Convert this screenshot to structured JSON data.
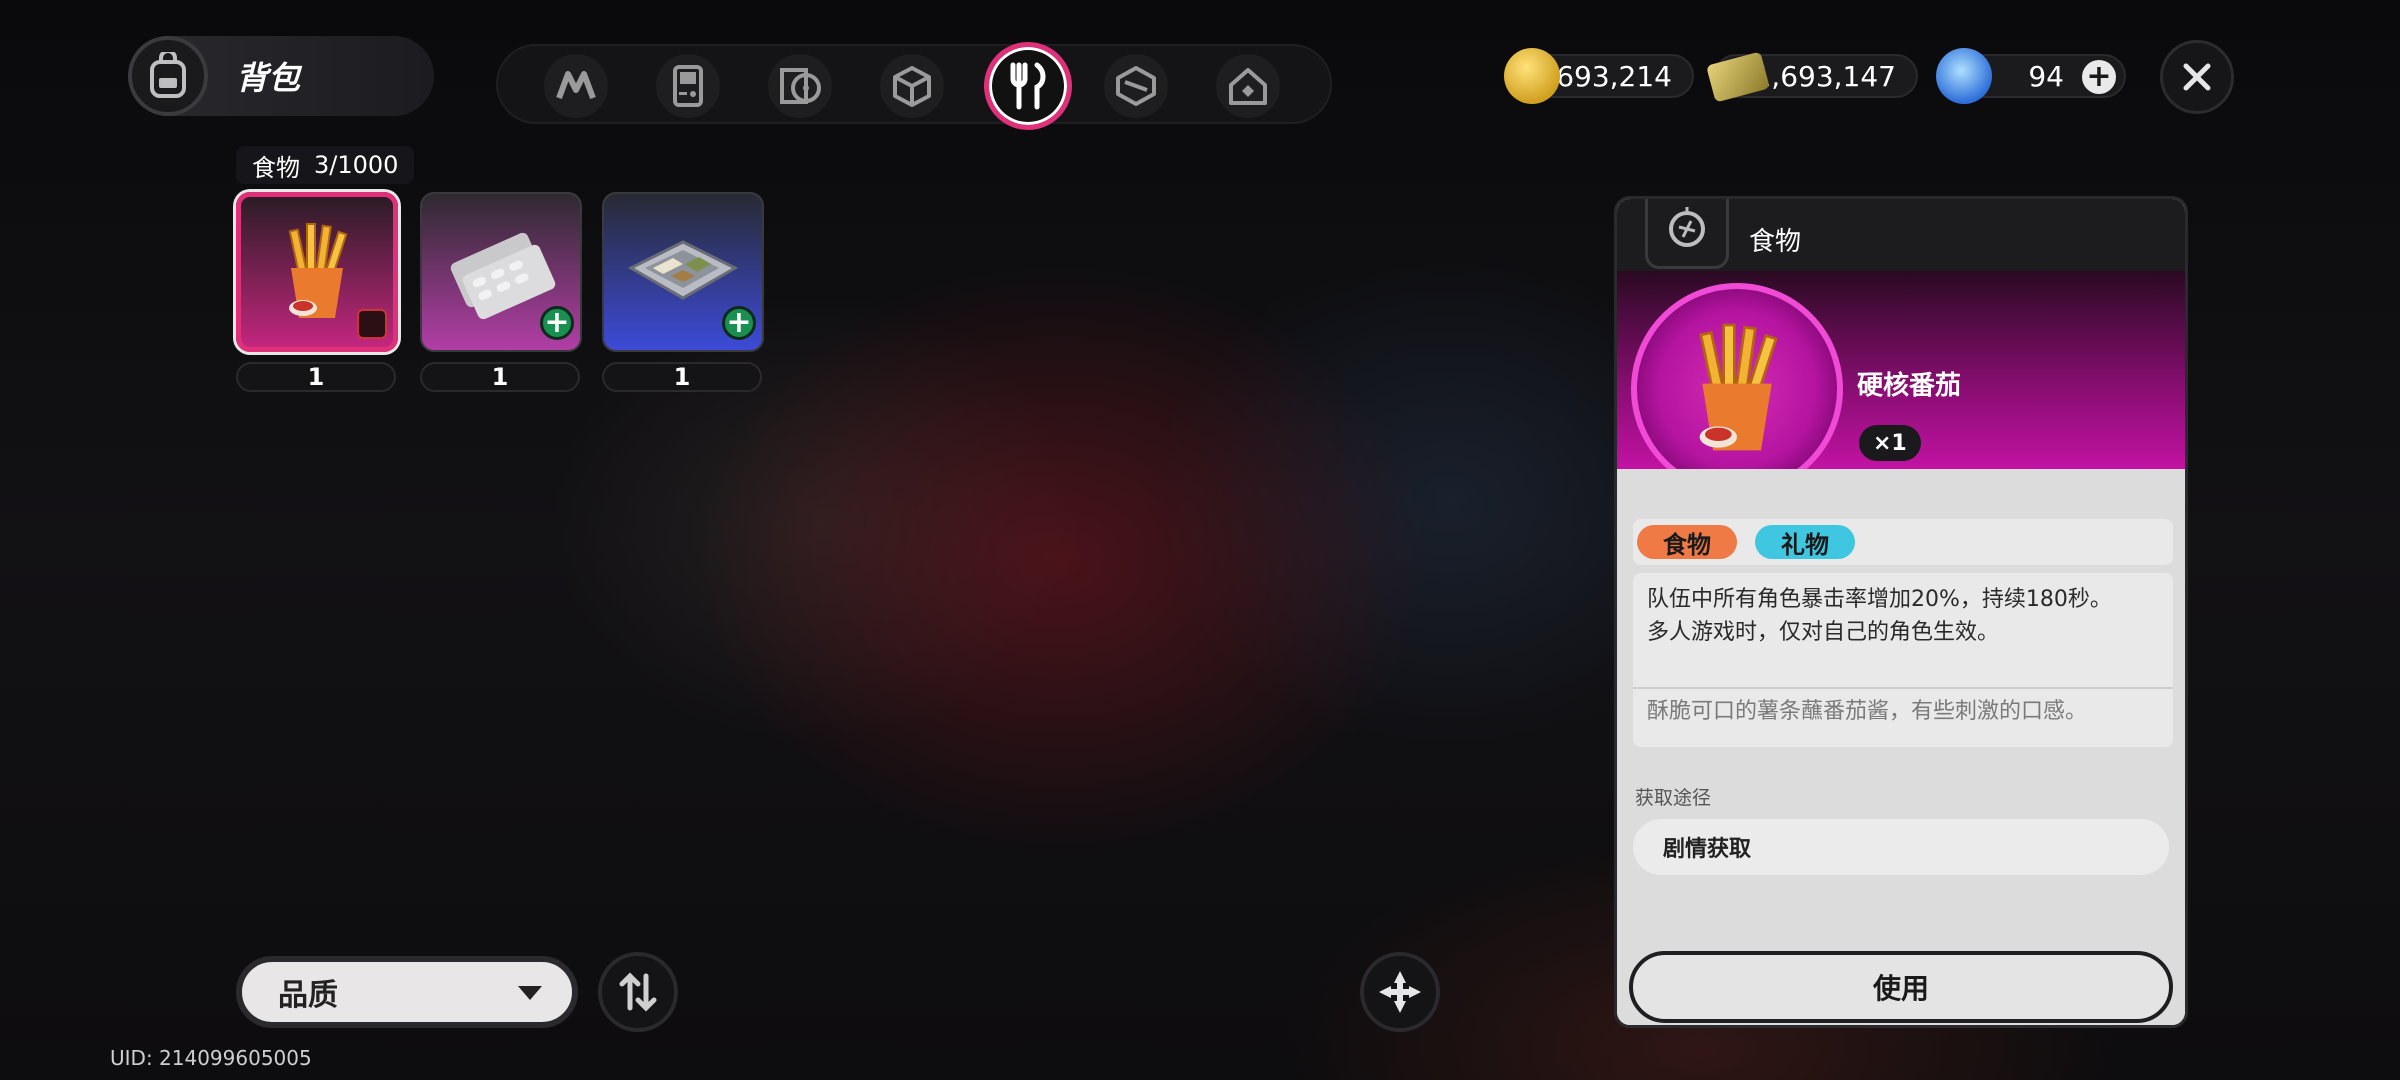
{
  "header": {
    "title": "背包",
    "tabs": [
      {
        "icon": "n-logo-icon"
      },
      {
        "icon": "gameboy-icon"
      },
      {
        "icon": "disc-record-icon"
      },
      {
        "icon": "cube-icon"
      },
      {
        "icon": "fork-knife-icon",
        "active": true
      },
      {
        "icon": "box-3d-icon"
      },
      {
        "icon": "house-icon"
      }
    ]
  },
  "currencies": [
    {
      "icon": "gold-coin-icon",
      "value": "693,214"
    },
    {
      "icon": "ticket-icon",
      "value": "1,693,147"
    },
    {
      "icon": "crystal-icon",
      "value": "94"
    }
  ],
  "inventory": {
    "category": "食物",
    "count": "3/1000",
    "items": [
      {
        "icon": "fries-icon",
        "count": "1",
        "rarity_color": "#e0307a",
        "selected": true
      },
      {
        "icon": "pills-icon",
        "count": "1",
        "rarity_color": "#b23ea6"
      },
      {
        "icon": "bento-icon",
        "count": "1",
        "rarity_color": "#3c4bd8"
      }
    ]
  },
  "bottom": {
    "sort_label": "品质",
    "uid": "UID: 214099605005"
  },
  "detail": {
    "category": "食物",
    "name": "硬核番茄",
    "qty": "×1",
    "tags": [
      {
        "label": "食物",
        "color": "#f07a45"
      },
      {
        "label": "礼物",
        "color": "#3fc6e0"
      }
    ],
    "effect_line1": "队伍中所有角色暴击率增加20%，持续180秒。",
    "effect_line2": "多人游戏时，仅对自己的角色生效。",
    "flavor": "酥脆可口的薯条蘸番茄酱，有些刺激的口感。",
    "obtain_title": "获取途径",
    "obtain_source": "剧情获取",
    "use_label": "使用"
  },
  "colors": {
    "accent": "#e0307a",
    "hero_magenta": "#c312a4"
  }
}
